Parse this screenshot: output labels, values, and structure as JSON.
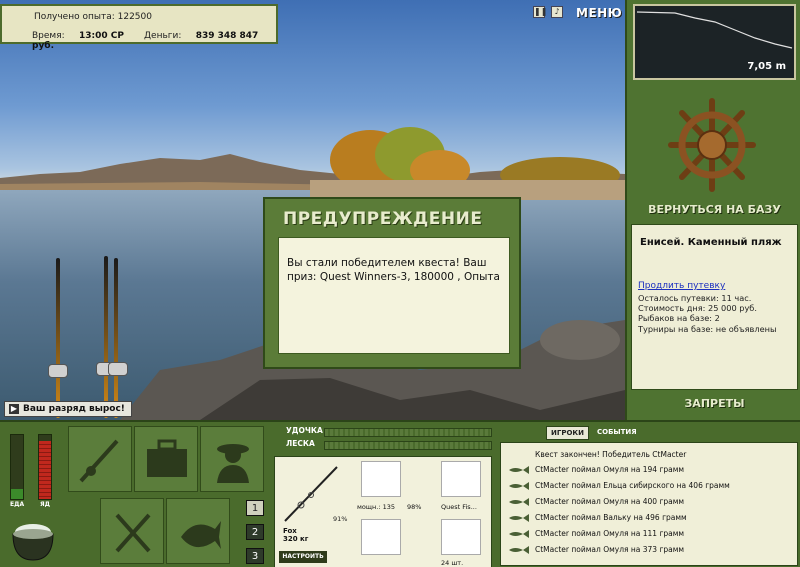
{
  "stats": {
    "xp_label": "Получено опыта:",
    "xp_value": "122500",
    "time_label": "Время:",
    "time_value": "13:00 СР",
    "money_label": "Деньги:",
    "money_value": "839 348 847 руб."
  },
  "top_bar": {
    "pause_icon": "pause-icon",
    "sound_icon": "sound-icon",
    "menu_label": "МЕНЮ"
  },
  "toast": {
    "text": "Ваш разряд вырос!"
  },
  "warning": {
    "title": "ПРЕДУПРЕЖДЕНИЕ",
    "message": "Вы стали победителем квеста! Ваш приз: Quest Winners-3, 180000 , Опыта"
  },
  "right_panel": {
    "depth": "7,05 m",
    "return_label": "ВЕРНУТЬСЯ НА БАЗУ",
    "location_title": "Енисей. Каменный пляж",
    "extend_link": "Продлить путевку",
    "permit_left": "Осталось путевки: 11 час.",
    "day_cost": "Стоимость дня: 25 000 руб.",
    "anglers": "Рыбаков на базе: 2",
    "tournaments": "Турниры на базе: не объявлены",
    "bans_label": "ЗАПРЕТЫ"
  },
  "meters": {
    "food_label": "ЕДА",
    "poison_label": "ЯД",
    "food_level": 0.15,
    "poison_level": 0.9,
    "food_color": "#3b8a2a",
    "poison_color": "#c0281d"
  },
  "slots": {
    "numbers": [
      "1",
      "2",
      "3"
    ],
    "active_index": 0
  },
  "tackle": {
    "rod_label": "УДОЧКА",
    "line_label": "ЛЕСКА",
    "rod_name": "Fox",
    "rod_weight": "320 кг",
    "rod_condition": "91%",
    "reel_power": "мощн.: 135",
    "reel_condition": "98%",
    "line_name": "Quest Fis...",
    "bait_count": "24 шт.",
    "setup_label": "НАСТРОИТЬ"
  },
  "players": {
    "tabs": [
      "ИГРОКИ",
      "СОБЫТИЯ"
    ],
    "active_tab": 0,
    "feed": [
      "Квест закончен! Победитель CtMacter",
      "CtMacter поймал Омуля на 194 грамм",
      "CtMacter поймал Ельца сибирского на 406 грамм",
      "CtMacter поймал Омуля на 400 грамм",
      "CtMacter поймал Вальку на 496 грамм",
      "CtMacter поймал Омуля на 111 грамм",
      "CtMacter поймал Омуля на 373 грамм"
    ]
  }
}
